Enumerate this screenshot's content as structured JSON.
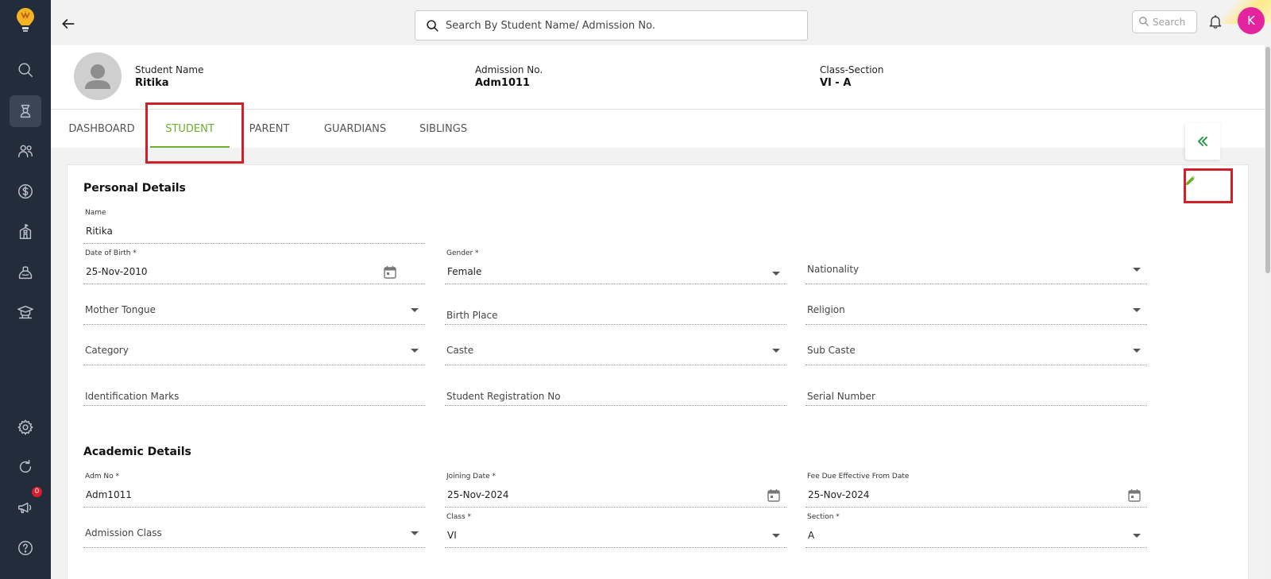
{
  "sidebar": {
    "items": [
      {
        "icon": "search-icon"
      },
      {
        "icon": "student-icon",
        "active": true
      },
      {
        "icon": "users-icon"
      },
      {
        "icon": "dollar-icon"
      },
      {
        "icon": "school-building-icon"
      },
      {
        "icon": "bag-icon"
      },
      {
        "icon": "graduation-cap-icon"
      },
      {
        "icon": "gear-icon"
      },
      {
        "icon": "refresh-icon"
      },
      {
        "icon": "megaphone-icon",
        "badge": "0"
      },
      {
        "icon": "help-icon"
      }
    ]
  },
  "topbar": {
    "search_placeholder": "Search By Student Name/ Admission No.",
    "mini_search_placeholder": "Search",
    "avatar_initial": "K"
  },
  "student": {
    "name_label": "Student Name",
    "name": "Ritika",
    "admission_label": "Admission No.",
    "admission_no": "Adm1011",
    "class_label": "Class-Section",
    "class_section": "VI - A"
  },
  "tabs": [
    "DASHBOARD",
    "STUDENT",
    "PARENT",
    "GUARDIANS",
    "SIBLINGS"
  ],
  "active_tab": "STUDENT",
  "personal": {
    "title": "Personal Details",
    "name_label": "Name",
    "name_value": "Ritika",
    "dob_label": "Date of Birth *",
    "dob_value": "25-Nov-2010",
    "gender_label": "Gender *",
    "gender_value": "Female",
    "nationality": "Nationality",
    "mother_tongue": "Mother Tongue",
    "birth_place": "Birth Place",
    "religion": "Religion",
    "category": "Category",
    "caste": "Caste",
    "sub_caste": "Sub Caste",
    "identification_marks": "Identification Marks",
    "student_registration_no": "Student Registration No",
    "serial_number": "Serial Number"
  },
  "academic": {
    "title": "Academic Details",
    "adm_no_label": "Adm No *",
    "adm_no_value": "Adm1011",
    "joining_date_label": "Joining Date *",
    "joining_date_value": "25-Nov-2024",
    "fee_due_label": "Fee Due Effective From Date",
    "fee_due_value": "25-Nov-2024",
    "admission_class": "Admission Class",
    "class_label": "Class *",
    "class_value": "VI",
    "section_label": "Section *",
    "section_value": "A"
  },
  "colors": {
    "sidebar": "#232c3a",
    "accent_green": "#6aaf2c",
    "highlight_red": "#d0202a",
    "avatar": "#e3249e"
  }
}
